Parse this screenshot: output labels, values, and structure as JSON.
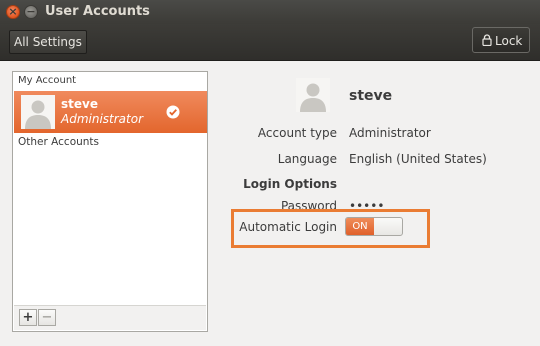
{
  "window": {
    "title": "User Accounts"
  },
  "toolbar": {
    "all_settings_label": "All Settings",
    "lock_label": "Lock"
  },
  "sidebar": {
    "my_account_label": "My Account",
    "current_user": {
      "name": "steve",
      "role": "Administrator"
    },
    "other_accounts_label": "Other Accounts",
    "add_label": "+",
    "remove_label": "−"
  },
  "detail": {
    "name": "steve",
    "account_type_label": "Account type",
    "account_type_value": "Administrator",
    "language_label": "Language",
    "language_value": "English (United States)",
    "login_options_label": "Login Options",
    "password_label": "Password",
    "password_value": "•••••",
    "auto_login_label": "Automatic Login",
    "auto_login_state": "ON"
  },
  "colors": {
    "accent": "#e3662d",
    "highlight_border": "#ea7c33",
    "toolbar": "#3c3b37"
  }
}
